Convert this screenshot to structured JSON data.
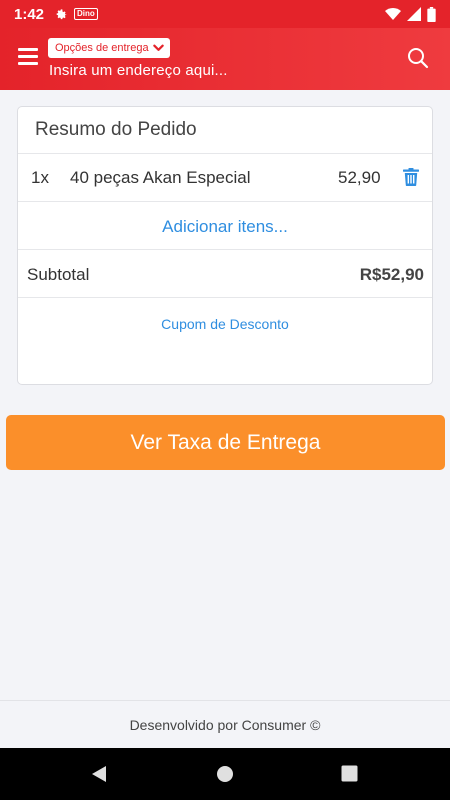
{
  "status_bar": {
    "time": "1:42",
    "mini_tag": "Dino"
  },
  "header": {
    "delivery_options_label": "Opções de entrega",
    "address_placeholder": "Insira um endereço aqui..."
  },
  "order_summary": {
    "title": "Resumo do Pedido",
    "items": [
      {
        "qty": "1x",
        "name": "40 peças Akan Especial",
        "price": "52,90"
      }
    ],
    "add_items_label": "Adicionar itens...",
    "subtotal_label": "Subtotal",
    "subtotal_value": "R$52,90",
    "coupon_label": "Cupom de Desconto"
  },
  "cta": {
    "label": "Ver Taxa de Entrega"
  },
  "footer": {
    "text": "Desenvolvido por Consumer ©"
  },
  "colors": {
    "brand_red": "#e4232a",
    "accent_orange": "#fb8f2a",
    "link_blue": "#2f8ee0"
  },
  "icons": {
    "menu": "hamburger-icon",
    "search": "search-icon",
    "trash": "trash-icon",
    "chevron": "chevron-down-icon"
  }
}
